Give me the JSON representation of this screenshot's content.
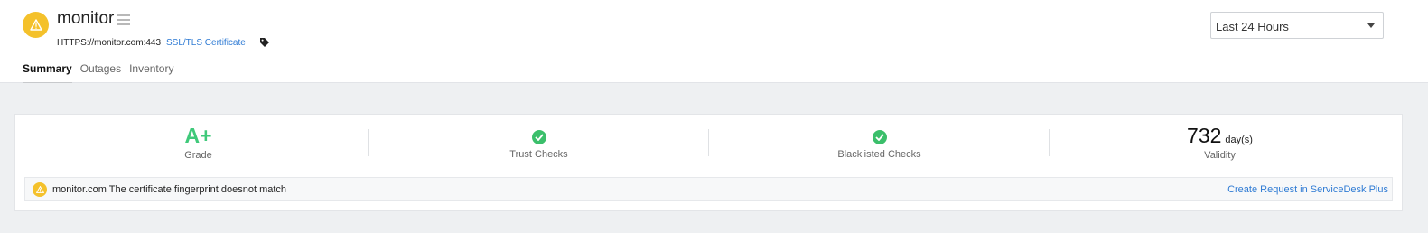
{
  "monitor": {
    "name": "monitor",
    "url": "HTTPS://monitor.com:443",
    "type_link": "SSL/TLS Certificate",
    "status_icon": "warning-icon",
    "status_color": "#f4c12b"
  },
  "tabs": [
    {
      "label": "Summary",
      "active": true
    },
    {
      "label": "Outages",
      "active": false
    },
    {
      "label": "Inventory",
      "active": false
    }
  ],
  "period_select": {
    "value": "Last 24 Hours"
  },
  "summary": {
    "grade": {
      "value": "A+",
      "label": "Grade",
      "color": "#3fc97a"
    },
    "trust_checks": {
      "label": "Trust Checks",
      "status": "check-circle-icon"
    },
    "blacklisted_checks": {
      "label": "Blacklisted Checks",
      "status": "check-circle-icon"
    },
    "validity": {
      "value": "732",
      "unit": "day(s)",
      "label": "Validity"
    }
  },
  "alert": {
    "icon": "warning-icon",
    "message": "monitor.com The certificate fingerprint doesnot match",
    "action_link": "Create Request in ServiceDesk Plus"
  },
  "colors": {
    "accent_link": "#2f7bd4",
    "success": "#3bbf6b",
    "warning": "#f4c12b"
  }
}
